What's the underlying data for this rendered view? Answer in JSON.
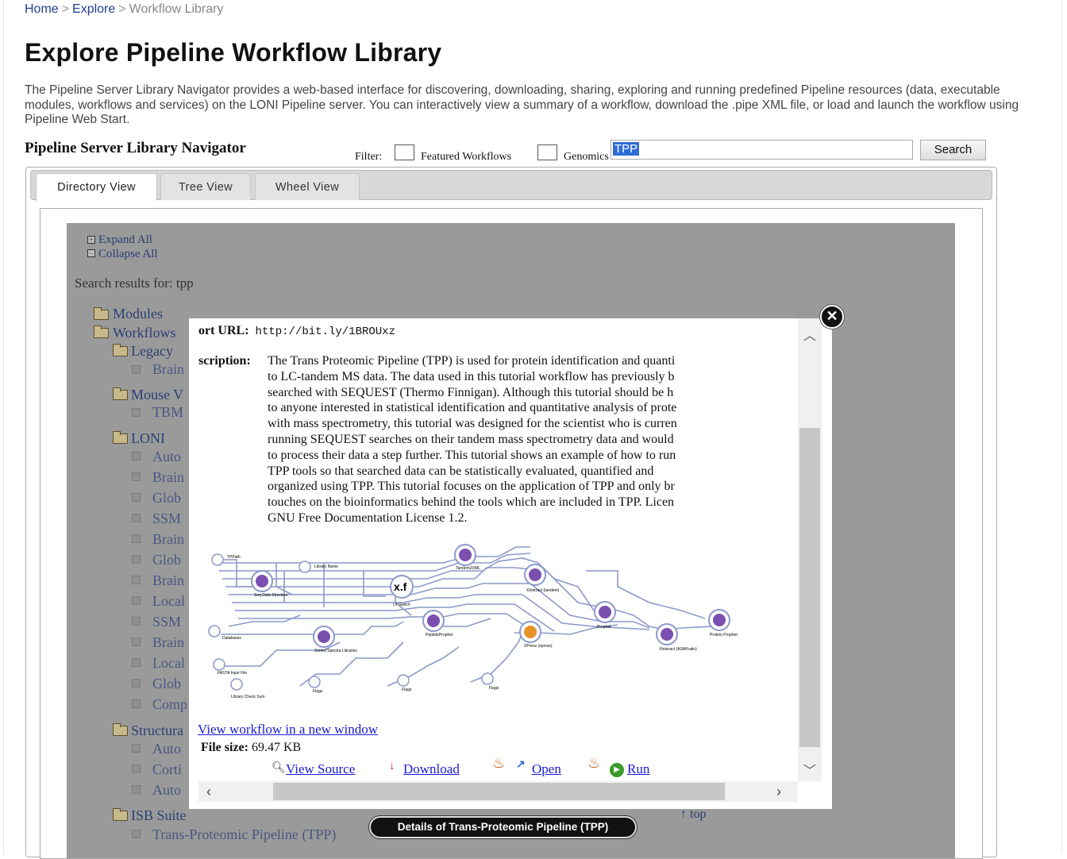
{
  "breadcrumb": {
    "home": "Home",
    "sep": ">",
    "explore": "Explore",
    "current": "Workflow Library"
  },
  "page_title": "Explore Pipeline Workflow Library",
  "intro": "The Pipeline Server Library Navigator provides a web-based interface for discovering, downloading, sharing, exploring and running predefined Pipeline resources (data, executable modules, workflows and services) on the LONI Pipeline server. You can interactively view a summary of a workflow, download the .pipe XML file, or load and launch the workflow using Pipeline Web Start.",
  "navigator": {
    "title": "Pipeline Server Library Navigator",
    "filter_label": "Filter:",
    "filter_featured": "Featured Workflows",
    "filter_genomics": "Genomics",
    "search_value": "TPP",
    "search_button": "Search"
  },
  "tabs": [
    "Directory View",
    "Tree View",
    "Wheel View"
  ],
  "directory": {
    "expand_all": "Expand All",
    "collapse_all": "Collapse All",
    "search_results": "Search results for: tpp",
    "modules": "Modules",
    "workflows": "Workflows",
    "legacy": "Legacy",
    "legacy_item": "Brain",
    "mouse": "Mouse V",
    "mouse_item": "TBM",
    "loni": "LONI",
    "loni_items": [
      "Auto",
      "Brain",
      "Glob",
      "SSM",
      "Brain",
      "Glob",
      "Brain",
      "Local",
      "SSM",
      "Brain",
      "Local",
      "Glob",
      "Comp"
    ],
    "structural": "Structura",
    "structural_items": [
      "Auto",
      "Corti",
      "Auto"
    ],
    "isb": "ISB Suite",
    "isb_item": "Trans-Proteomic Pipeline (TPP)",
    "top_link": "↑ top"
  },
  "modal": {
    "short_url_label": "ort URL:",
    "short_url": "http://bit.ly/1BROUxz",
    "description_label": "scription:",
    "description_lines": [
      "The Trans Proteomic Pipeline (TPP) is used for protein identification and quanti",
      "to LC-tandem MS data. The data used in this tutorial workflow has previously b",
      "searched with SEQUEST (Thermo Finnigan). Although this tutorial should be h",
      "to anyone interested in statistical identification and quantitative analysis of prote",
      "with mass spectrometry, this tutorial was designed for the scientist who is curren",
      "running SEQUEST searches on their tandem mass spectrometry data and would",
      "to process their data a step further. This tutorial shows an example of how to run",
      "TPP tools so that searched data can be statistically evaluated, quantified and",
      "organized using TPP. This tutorial focuses on the application of TPP and only br",
      "touches on the bioinformatics behind the tools which are included in TPP. Licen",
      "GNU Free Documentation License 1.2."
    ],
    "view_workflow_link": "View workflow in a new window",
    "file_size_label": "File size:",
    "file_size_value": "69.47 KB",
    "actions": {
      "view_source": "View Source",
      "download": "Download",
      "open": "Open",
      "run": "Run"
    },
    "close_icon": "close-icon"
  },
  "tooltip": "Details of Trans-Proteomic Pipeline (TPP)",
  "diagram_labels": {
    "tpp": "TPPath",
    "library_name": "Library Name",
    "tandem": "Tandem2XML",
    "seq_data": "Seq Data Structure",
    "xf": "x.f",
    "xf_sub": "L/I Switch",
    "xinteract": "XInteract (tandem)",
    "peptide": "PeptideProphet",
    "databases": "Databases",
    "sorted": "Sorted Spectra Libraries",
    "xpress": "XPress (xpress)",
    "fasta": "FASTA Input File",
    "pep": "Prophet",
    "protein_prophet": "Protein Prophet",
    "xinteract2": "XInteract (ASAPratio)",
    "checksum": "Library Check Sum",
    "flags1": "Flags",
    "flags2": "Flags",
    "flags3": "Flags"
  },
  "colors": {
    "link": "#1a1ad6",
    "breadcrumb_link": "#1f3f8f",
    "overlay": "#9a9a9a",
    "node_purple": "#7a4fb0",
    "node_orange": "#e8902a",
    "diagram_line": "#8b99c9"
  }
}
